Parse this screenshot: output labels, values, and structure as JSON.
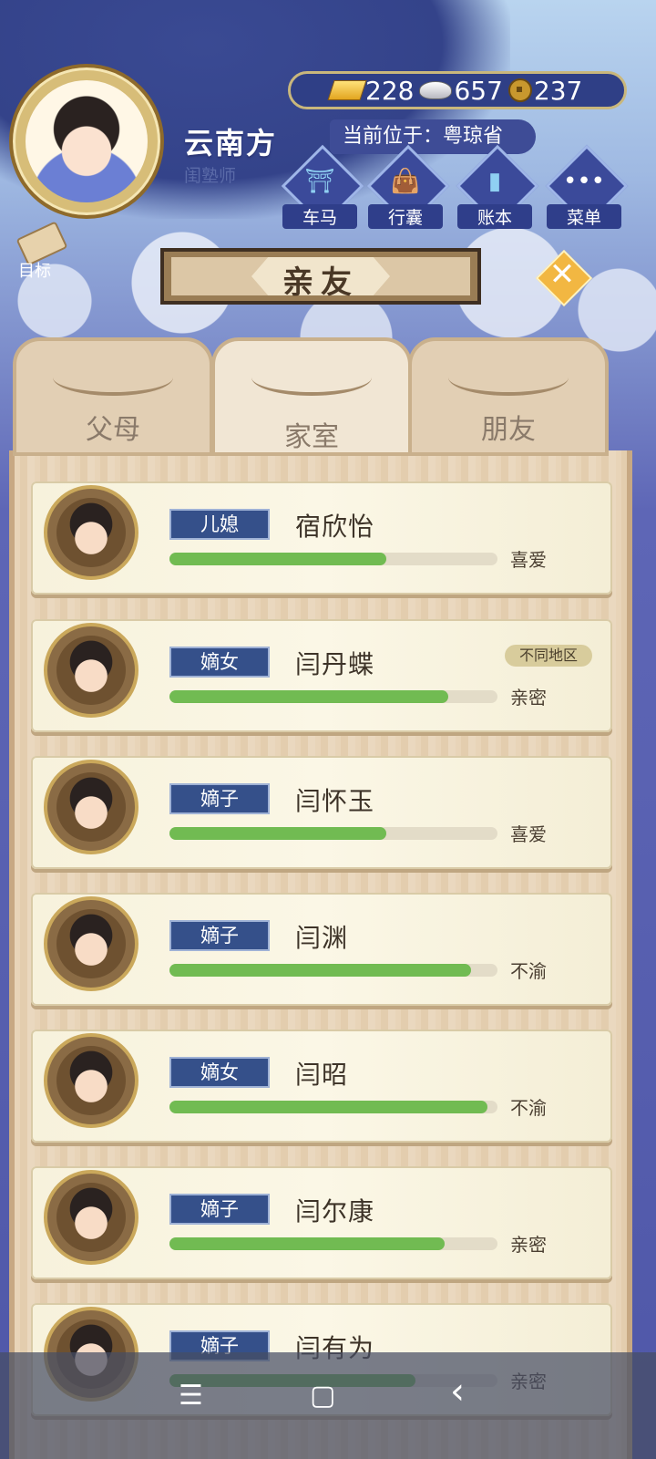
{
  "player": {
    "name": "云南方",
    "title": "闺塾师",
    "location_label": "当前位于：粤琼省"
  },
  "currency": {
    "gold": "228",
    "silver": "657",
    "coins": "237"
  },
  "menu": [
    {
      "label": "车马",
      "icon": "carriage-icon",
      "glyph": "⛩"
    },
    {
      "label": "行囊",
      "icon": "bag-icon",
      "glyph": "👜"
    },
    {
      "label": "账本",
      "icon": "ledger-icon",
      "glyph": "▮"
    },
    {
      "label": "菜单",
      "icon": "menu-dots-icon",
      "glyph": "•••"
    }
  ],
  "goal_label": "目标",
  "panel": {
    "title": "亲友",
    "close_glyph": "✕"
  },
  "tabs": [
    {
      "label": "父母",
      "active": false
    },
    {
      "label": "家室",
      "active": true
    },
    {
      "label": "朋友",
      "active": false
    }
  ],
  "members": [
    {
      "role": "儿媳",
      "name": "宿欣怡",
      "affinity": 0.66,
      "relation": "喜爱",
      "badge": ""
    },
    {
      "role": "嫡女",
      "name": "闫丹蝶",
      "affinity": 0.85,
      "relation": "亲密",
      "badge": "不同地区"
    },
    {
      "role": "嫡子",
      "name": "闫怀玉",
      "affinity": 0.66,
      "relation": "喜爱",
      "badge": ""
    },
    {
      "role": "嫡子",
      "name": "闫渊",
      "affinity": 0.92,
      "relation": "不渝",
      "badge": ""
    },
    {
      "role": "嫡女",
      "name": "闫昭",
      "affinity": 0.97,
      "relation": "不渝",
      "badge": ""
    },
    {
      "role": "嫡子",
      "name": "闫尔康",
      "affinity": 0.84,
      "relation": "亲密",
      "badge": ""
    },
    {
      "role": "嫡子",
      "name": "闫有为",
      "affinity": 0.75,
      "relation": "亲密",
      "badge": ""
    }
  ],
  "system_nav": {
    "menu": "☰",
    "home": "▢",
    "back": "‹"
  },
  "colors": {
    "bar_fill": "#71bb52",
    "role_tag": "#35508a",
    "panel_header": "#9a7d55"
  }
}
